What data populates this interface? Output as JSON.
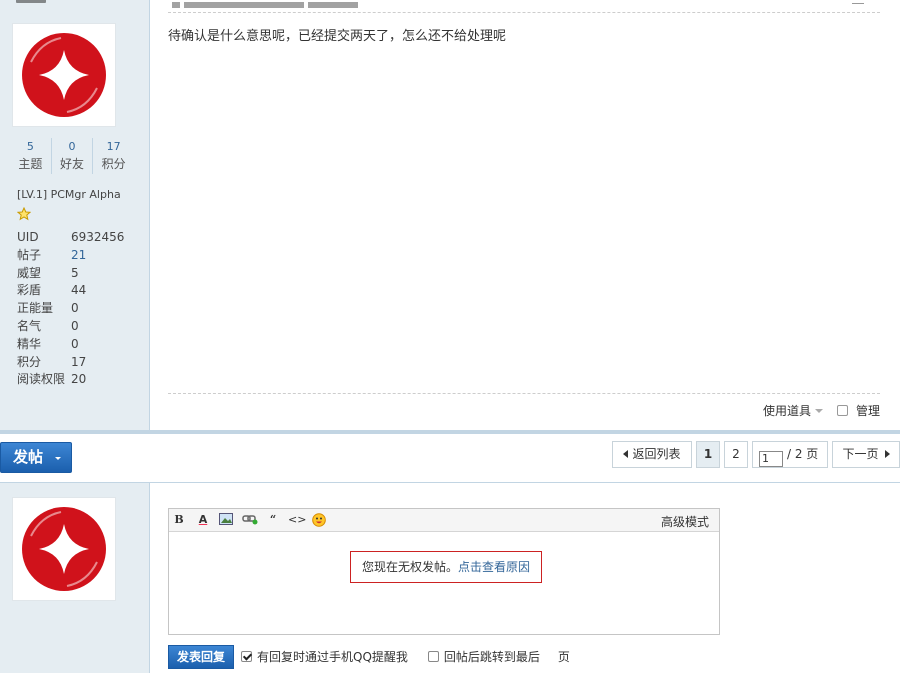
{
  "post": {
    "content": "待确认是什么意思呢，已经提交两天了，怎么还不给处理呢",
    "tools_label": "使用道具",
    "manage_label": "管理"
  },
  "author": {
    "stats": [
      {
        "num": "5",
        "label": "主题"
      },
      {
        "num": "0",
        "label": "好友"
      },
      {
        "num": "17",
        "label": "积分"
      }
    ],
    "rank": "[LV.1] PCMgr Alpha",
    "info": [
      {
        "k": "UID",
        "v": "6932456",
        "link": false
      },
      {
        "k": "帖子",
        "v": "21",
        "link": true
      },
      {
        "k": "威望",
        "v": "5",
        "link": false
      },
      {
        "k": "彩盾",
        "v": "44",
        "link": false
      },
      {
        "k": "正能量",
        "v": "0",
        "link": false
      },
      {
        "k": "名气",
        "v": "0",
        "link": false
      },
      {
        "k": "精华",
        "v": "0",
        "link": false
      },
      {
        "k": "积分",
        "v": "17",
        "link": false
      },
      {
        "k": "阅读权限",
        "v": "20",
        "link": false
      }
    ]
  },
  "pager": {
    "post_button": "发帖",
    "back": "返回列表",
    "page1": "1",
    "page2": "2",
    "current": "1",
    "total": "/ 2 页",
    "next": "下一页"
  },
  "reply": {
    "advanced": "高级模式",
    "notice_text": "您现在无权发帖。",
    "notice_link": "点击查看原因",
    "submit": "发表回复",
    "opt1": "有回复时通过手机QQ提醒我",
    "opt1_checked": true,
    "opt2": "回帖后跳转到最后",
    "opt2_tail": "页"
  },
  "colors": {
    "link": "#336699",
    "accent": "#1b5fad",
    "brand_red": "#d0121b"
  }
}
